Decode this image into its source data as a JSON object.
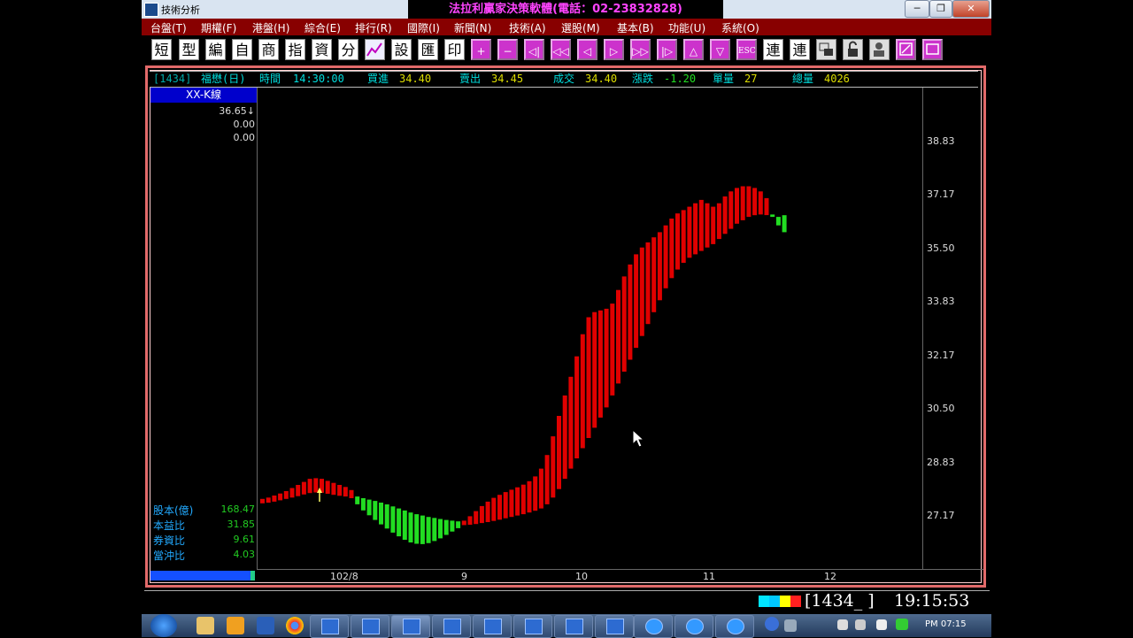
{
  "window": {
    "title": "技術分析",
    "banner": "法拉利贏家決策軟體(電話：02-23832828)",
    "controls": {
      "minimize": "─",
      "restore": "❐",
      "close": "✕"
    }
  },
  "menu": [
    {
      "label": "台盤(T)"
    },
    {
      "label": "期權(F)"
    },
    {
      "label": "港盤(H)"
    },
    {
      "label": "綜合(E)"
    },
    {
      "label": "排行(R)"
    },
    {
      "label": "國際(I)"
    },
    {
      "label": "新聞(N)"
    },
    {
      "label": "技術(A)"
    },
    {
      "label": "選股(M)"
    },
    {
      "label": "基本(B)"
    },
    {
      "label": "功能(U)"
    },
    {
      "label": "系統(O)"
    }
  ],
  "toolbar": {
    "text_buttons": [
      "短",
      "型",
      "編",
      "自",
      "商",
      "指",
      "資",
      "分"
    ],
    "text_buttons2": [
      "設",
      "匯",
      "印"
    ],
    "arrow_buttons": [
      "+",
      "−",
      "◁|",
      "◁◁",
      "◁",
      "▷",
      "▷▷",
      "|▷",
      "△",
      "▽"
    ],
    "text_buttons3": [
      "連",
      "連"
    ]
  },
  "quote": {
    "code": "[1434]",
    "name": "福懋(日)",
    "time_label": "時間",
    "time": "14:30:00",
    "bid_label": "買進",
    "bid": "34.40",
    "ask_label": "賣出",
    "ask": "34.45",
    "last_label": "成交",
    "last": "34.40",
    "change_label": "漲跌",
    "change": "-1.20",
    "vol_label": "單量",
    "vol": "27",
    "total_label": "總量",
    "total": "4026"
  },
  "left_panel": {
    "title": "XX-K線",
    "values": [
      "36.65↓",
      "0.00",
      "0.00"
    ],
    "stats": [
      {
        "label": "股本(億)",
        "value": "168.47"
      },
      {
        "label": "本益比",
        "value": "31.85"
      },
      {
        "label": "券資比",
        "value": "9.61"
      },
      {
        "label": "當沖比",
        "value": "4.03"
      }
    ]
  },
  "chart_data": {
    "type": "bar",
    "title": "",
    "xlabel": "",
    "ylabel": "",
    "y_ticks": [
      "38.83",
      "37.17",
      "35.50",
      "33.83",
      "32.17",
      "30.50",
      "28.83",
      "27.17"
    ],
    "x_ticks": [
      "102/8",
      "9",
      "10",
      "11",
      "12"
    ],
    "ylim": [
      26.2,
      40.35
    ],
    "up_color": "#e00000",
    "down_color": "#22dd22",
    "grid": false,
    "series": [
      {
        "values": [
          {
            "open": 28.13,
            "close": 28.26,
            "color": "up"
          },
          {
            "open": 28.15,
            "close": 28.3,
            "color": "up"
          },
          {
            "open": 28.18,
            "close": 28.36,
            "color": "up"
          },
          {
            "open": 28.22,
            "close": 28.42,
            "color": "up"
          },
          {
            "open": 28.26,
            "close": 28.49,
            "color": "up"
          },
          {
            "open": 28.3,
            "close": 28.58,
            "color": "up"
          },
          {
            "open": 28.34,
            "close": 28.67,
            "color": "up"
          },
          {
            "open": 28.39,
            "close": 28.76,
            "color": "up"
          },
          {
            "open": 28.43,
            "close": 28.85,
            "color": "up"
          },
          {
            "open": 28.45,
            "close": 28.87,
            "color": "up"
          },
          {
            "open": 28.44,
            "close": 28.85,
            "color": "up"
          },
          {
            "open": 28.41,
            "close": 28.79,
            "color": "up"
          },
          {
            "open": 28.38,
            "close": 28.73,
            "color": "up"
          },
          {
            "open": 28.35,
            "close": 28.67,
            "color": "up"
          },
          {
            "open": 28.33,
            "close": 28.61,
            "color": "up"
          },
          {
            "open": 28.28,
            "close": 28.52,
            "color": "up"
          },
          {
            "open": 28.33,
            "close": 28.1,
            "color": "down"
          },
          {
            "open": 28.28,
            "close": 27.92,
            "color": "down"
          },
          {
            "open": 28.24,
            "close": 27.78,
            "color": "down"
          },
          {
            "open": 28.2,
            "close": 27.64,
            "color": "down"
          },
          {
            "open": 28.15,
            "close": 27.51,
            "color": "down"
          },
          {
            "open": 28.1,
            "close": 27.39,
            "color": "down"
          },
          {
            "open": 28.04,
            "close": 27.27,
            "color": "down"
          },
          {
            "open": 27.98,
            "close": 27.16,
            "color": "down"
          },
          {
            "open": 27.92,
            "close": 27.06,
            "color": "down"
          },
          {
            "open": 27.86,
            "close": 26.98,
            "color": "down"
          },
          {
            "open": 27.81,
            "close": 26.94,
            "color": "down"
          },
          {
            "open": 27.77,
            "close": 26.93,
            "color": "down"
          },
          {
            "open": 27.73,
            "close": 26.96,
            "color": "down"
          },
          {
            "open": 27.7,
            "close": 27.02,
            "color": "down"
          },
          {
            "open": 27.67,
            "close": 27.1,
            "color": "down"
          },
          {
            "open": 27.64,
            "close": 27.2,
            "color": "down"
          },
          {
            "open": 27.62,
            "close": 27.3,
            "color": "down"
          },
          {
            "open": 27.6,
            "close": 27.4,
            "color": "down"
          },
          {
            "open": 27.49,
            "close": 27.62,
            "color": "up"
          },
          {
            "open": 27.5,
            "close": 27.75,
            "color": "up"
          },
          {
            "open": 27.52,
            "close": 27.9,
            "color": "up"
          },
          {
            "open": 27.55,
            "close": 28.05,
            "color": "up"
          },
          {
            "open": 27.58,
            "close": 28.18,
            "color": "up"
          },
          {
            "open": 27.61,
            "close": 28.29,
            "color": "up"
          },
          {
            "open": 27.65,
            "close": 28.38,
            "color": "up"
          },
          {
            "open": 27.69,
            "close": 28.46,
            "color": "up"
          },
          {
            "open": 27.73,
            "close": 28.53,
            "color": "up"
          },
          {
            "open": 27.77,
            "close": 28.6,
            "color": "up"
          },
          {
            "open": 27.81,
            "close": 28.68,
            "color": "up"
          },
          {
            "open": 27.86,
            "close": 28.78,
            "color": "up"
          },
          {
            "open": 27.91,
            "close": 28.92,
            "color": "up"
          },
          {
            "open": 27.98,
            "close": 29.15,
            "color": "up"
          },
          {
            "open": 28.1,
            "close": 29.55,
            "color": "up"
          },
          {
            "open": 28.3,
            "close": 30.1,
            "color": "up"
          },
          {
            "open": 28.55,
            "close": 30.7,
            "color": "up"
          },
          {
            "open": 28.85,
            "close": 31.3,
            "color": "up"
          },
          {
            "open": 29.15,
            "close": 31.85,
            "color": "up"
          },
          {
            "open": 29.45,
            "close": 32.45,
            "color": "up"
          },
          {
            "open": 29.75,
            "close": 33.1,
            "color": "up"
          },
          {
            "open": 30.05,
            "close": 33.6,
            "color": "up"
          },
          {
            "open": 30.35,
            "close": 33.75,
            "color": "up"
          },
          {
            "open": 30.65,
            "close": 33.8,
            "color": "up"
          },
          {
            "open": 30.95,
            "close": 33.85,
            "color": "up"
          },
          {
            "open": 31.3,
            "close": 34.0,
            "color": "up"
          },
          {
            "open": 31.65,
            "close": 34.4,
            "color": "up"
          },
          {
            "open": 32.0,
            "close": 34.8,
            "color": "up"
          },
          {
            "open": 32.35,
            "close": 35.15,
            "color": "up"
          },
          {
            "open": 32.7,
            "close": 35.45,
            "color": "up"
          },
          {
            "open": 33.05,
            "close": 35.65,
            "color": "up"
          },
          {
            "open": 33.4,
            "close": 35.8,
            "color": "up"
          },
          {
            "open": 33.75,
            "close": 35.95,
            "color": "up"
          },
          {
            "open": 34.1,
            "close": 36.1,
            "color": "up"
          },
          {
            "open": 34.45,
            "close": 36.3,
            "color": "up"
          },
          {
            "open": 34.75,
            "close": 36.5,
            "color": "up"
          },
          {
            "open": 35.0,
            "close": 36.65,
            "color": "up"
          },
          {
            "open": 35.2,
            "close": 36.75,
            "color": "up"
          },
          {
            "open": 35.35,
            "close": 36.85,
            "color": "up"
          },
          {
            "open": 35.45,
            "close": 36.95,
            "color": "up"
          },
          {
            "open": 35.55,
            "close": 37.05,
            "color": "up"
          },
          {
            "open": 35.65,
            "close": 36.95,
            "color": "up"
          },
          {
            "open": 35.75,
            "close": 36.85,
            "color": "up"
          },
          {
            "open": 35.9,
            "close": 36.95,
            "color": "up"
          },
          {
            "open": 36.05,
            "close": 37.15,
            "color": "up"
          },
          {
            "open": 36.2,
            "close": 37.3,
            "color": "up"
          },
          {
            "open": 36.35,
            "close": 37.4,
            "color": "up"
          },
          {
            "open": 36.45,
            "close": 37.45,
            "color": "up"
          },
          {
            "open": 36.55,
            "close": 37.45,
            "color": "up"
          },
          {
            "open": 36.6,
            "close": 37.4,
            "color": "up"
          },
          {
            "open": 36.62,
            "close": 37.3,
            "color": "up"
          },
          {
            "open": 36.6,
            "close": 37.1,
            "color": "up"
          },
          {
            "open": 36.62,
            "close": 36.55,
            "color": "down"
          },
          {
            "open": 36.55,
            "close": 36.3,
            "color": "down"
          },
          {
            "open": 36.6,
            "close": 36.1,
            "color": "down"
          }
        ]
      }
    ]
  },
  "statusbar": {
    "code_display": "[1434_  ]",
    "time_display": "19:15:53",
    "swatches": [
      "#00e5ff",
      "#00c8ff",
      "#ffff00",
      "#ff2020"
    ]
  },
  "taskbar": {
    "clock": "PM 07:15"
  }
}
